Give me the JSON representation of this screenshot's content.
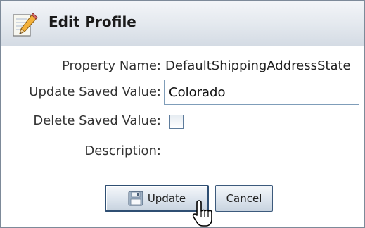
{
  "dialog": {
    "title": "Edit Profile"
  },
  "form": {
    "property_name_label": "Property Name:",
    "property_name_value": "DefaultShippingAddressState",
    "update_label": "Update Saved Value:",
    "update_value": "Colorado",
    "delete_label": "Delete Saved Value:",
    "delete_checked": false,
    "description_label": "Description:"
  },
  "buttons": {
    "update_label": "Update",
    "cancel_label": "Cancel"
  },
  "icons": {
    "title": "pencil-note-icon",
    "update": "floppy-disk-icon",
    "cursor": "hand-pointer-icon"
  }
}
